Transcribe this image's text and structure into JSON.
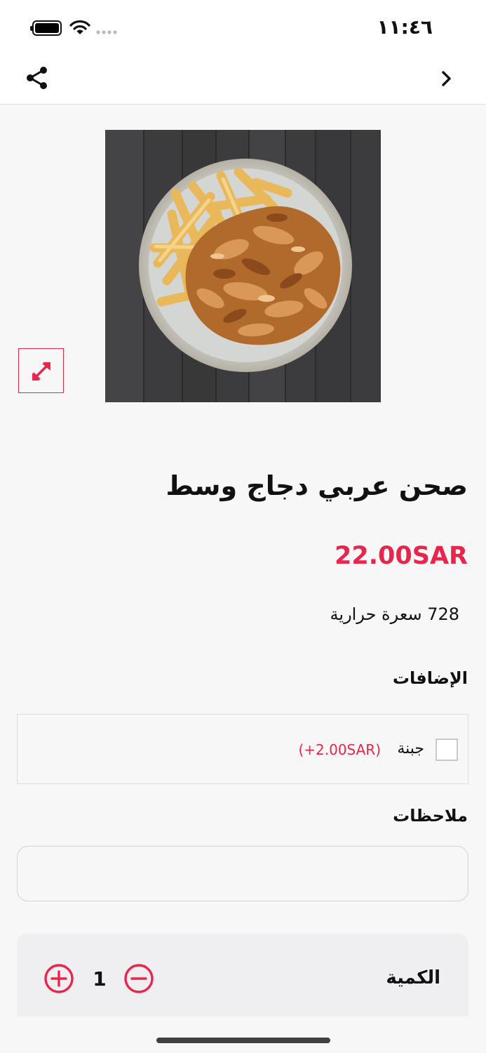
{
  "status_bar": {
    "time": "١١:٤٦",
    "battery_icon": "battery-icon",
    "wifi_icon": "wifi-icon",
    "signal_icon": "cellular-signal-icon"
  },
  "nav": {
    "share_icon": "share-icon",
    "back_icon": "chevron-right-icon"
  },
  "product": {
    "image_icon": "food-photo-shawarma-plate",
    "expand_icon": "expand-arrows-icon",
    "title": "صحن عربي دجاج وسط",
    "price": "22.00SAR",
    "calories": "728 سعرة حرارية"
  },
  "addons": {
    "title": "الإضافات",
    "items": [
      {
        "name": "جبنة",
        "price": "(+2.00SAR)",
        "checked": false
      }
    ]
  },
  "notes": {
    "title": "ملاحظات",
    "value": "",
    "placeholder": ""
  },
  "quantity": {
    "label": "الكمية",
    "value": "1",
    "plus_icon": "plus-circle-icon",
    "minus_icon": "minus-circle-icon"
  },
  "colors": {
    "accent": "#e8264c",
    "background": "#f7f7f7",
    "panel": "#efeff2"
  }
}
